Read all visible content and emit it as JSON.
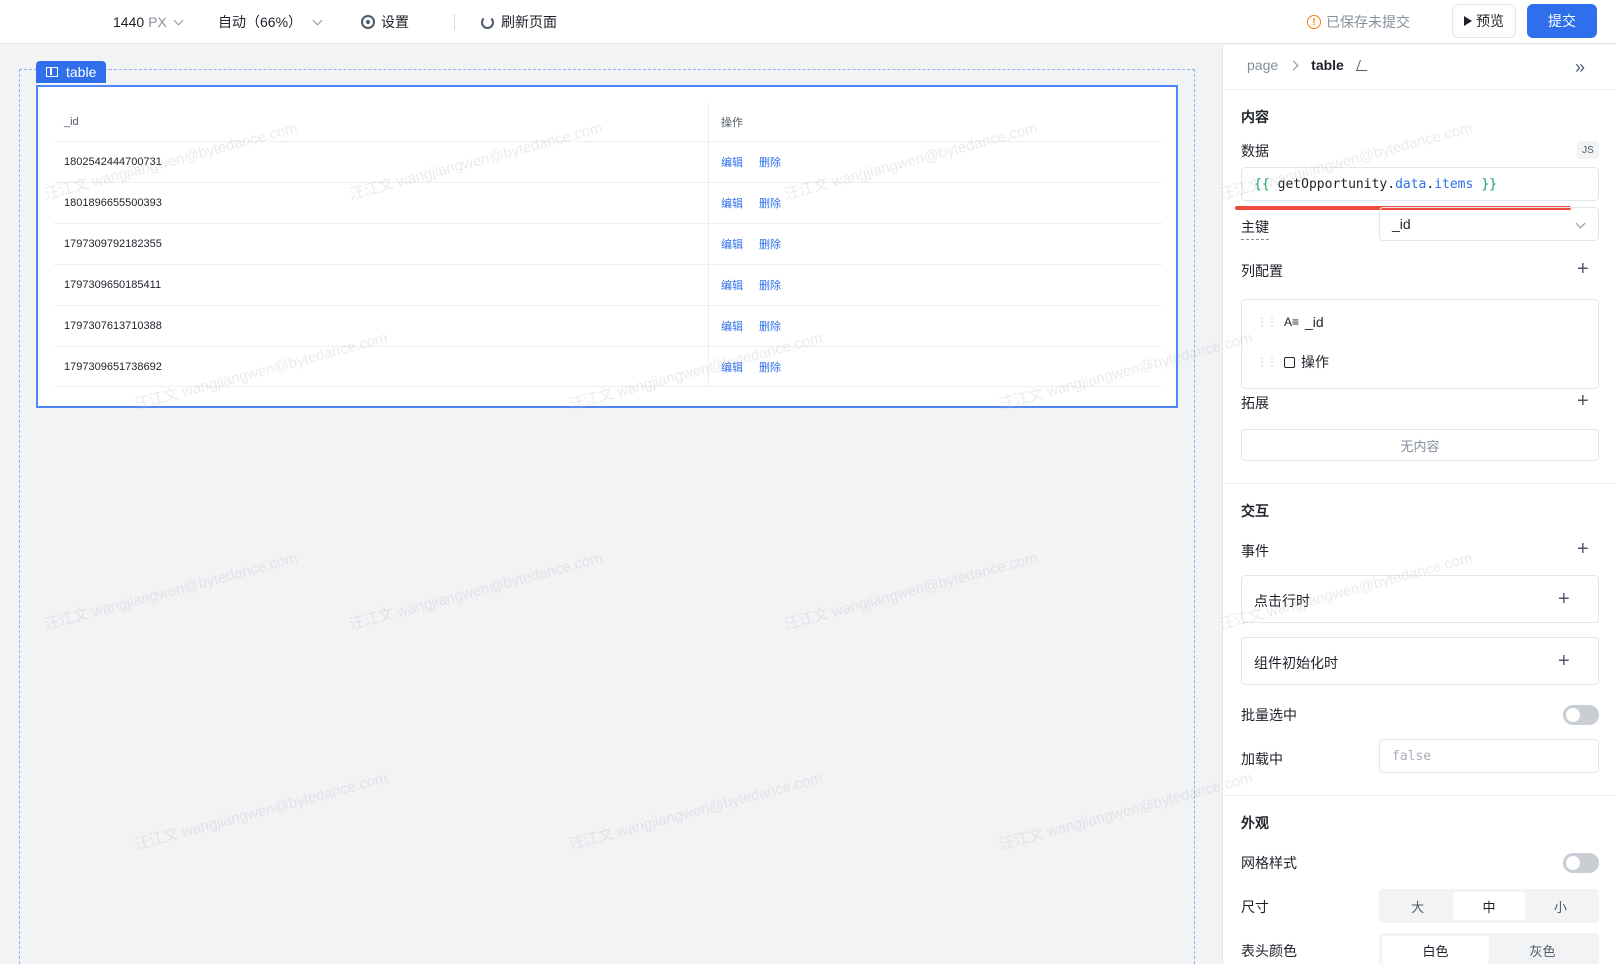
{
  "toolbar": {
    "width_value": "1440",
    "width_unit": "PX",
    "zoom": "自动（66%）",
    "settings": "设置",
    "refresh": "刷新页面",
    "status": "已保存未提交",
    "preview": "预览",
    "submit": "提交"
  },
  "canvas": {
    "component_tag": "table",
    "table": {
      "columns": [
        "_id",
        "操作"
      ],
      "rows": [
        {
          "id": "1802542444700731",
          "edit": "编辑",
          "delete": "删除"
        },
        {
          "id": "1801896655500393",
          "edit": "编辑",
          "delete": "删除"
        },
        {
          "id": "1797309792182355",
          "edit": "编辑",
          "delete": "删除"
        },
        {
          "id": "1797309650185411",
          "edit": "编辑",
          "delete": "删除"
        },
        {
          "id": "1797307613710388",
          "edit": "编辑",
          "delete": "删除"
        },
        {
          "id": "1797309651738692",
          "edit": "编辑",
          "delete": "删除"
        }
      ]
    }
  },
  "panel": {
    "breadcrumb": {
      "root": "page",
      "current": "table"
    },
    "content": {
      "title": "内容",
      "data_label": "数据",
      "js_badge": "JS",
      "data_expr": {
        "open": "{{",
        "fn": "getOpportunity.",
        "p1": "data",
        "dot": ".",
        "p2": "items",
        "close": "}}"
      },
      "primary_key_label": "主键",
      "primary_key_value": "_id",
      "column_config_label": "列配置",
      "columns": [
        {
          "glyph": "A≡",
          "name": "_id"
        },
        {
          "glyph": "",
          "name": "操作"
        }
      ],
      "extension_label": "拓展",
      "extension_empty": "无内容"
    },
    "interaction": {
      "title": "交互",
      "events_label": "事件",
      "events": [
        "点击行时",
        "组件初始化时"
      ],
      "batch_select_label": "批量选中",
      "loading_label": "加载中",
      "loading_value": "false"
    },
    "appearance": {
      "title": "外观",
      "grid_style_label": "网格样式",
      "size_label": "尺寸",
      "size_options": [
        "大",
        "中",
        "小"
      ],
      "size_selected": "中",
      "header_color_label": "表头颜色",
      "header_color_options": [
        "白色",
        "灰色"
      ],
      "header_color_selected": "白色"
    }
  },
  "watermark": {
    "name": "汪江文",
    "email": "wangjiangwen@bytedance.com"
  }
}
